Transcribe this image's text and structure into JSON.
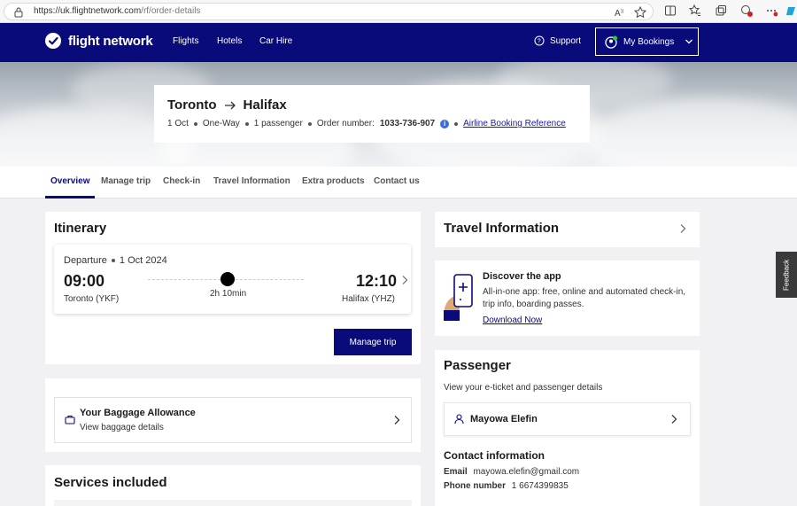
{
  "browser": {
    "url_host": "https://uk.flightnetwork.com",
    "url_path": "/rf/order-details"
  },
  "nav": {
    "brand": "flight network",
    "links": [
      "Flights",
      "Hotels",
      "Car Hire"
    ],
    "support": "Support",
    "my_bookings": "My Bookings"
  },
  "summary": {
    "origin": "Toronto",
    "destination": "Halifax",
    "date": "1 Oct",
    "trip_type": "One-Way",
    "passengers": "1 passenger",
    "order_label": "Order number:",
    "order_number": "1033-736-907",
    "booking_ref_link": "Airline Booking Reference"
  },
  "tabs": [
    "Overview",
    "Manage trip",
    "Check-in",
    "Travel Information",
    "Extra products",
    "Contact us"
  ],
  "itinerary": {
    "title": "Itinerary",
    "departure_label": "Departure",
    "departure_date": "1 Oct 2024",
    "dep_time": "09:00",
    "dep_place": "Toronto (YKF)",
    "duration": "2h 10min",
    "arr_time": "12:10",
    "arr_place": "Halifax (YHZ)",
    "manage_button": "Manage trip"
  },
  "baggage": {
    "title": "Your Baggage Allowance",
    "subtitle": "View baggage details"
  },
  "services": {
    "title": "Services included"
  },
  "travel_info": {
    "title": "Travel Information"
  },
  "app_promo": {
    "title": "Discover the app",
    "text": "All-in-one app: free, online and automated check-in, trip info, boarding passes.",
    "link": "Download Now"
  },
  "passenger": {
    "title": "Passenger",
    "subtitle": "View your e-ticket and passenger details",
    "name": "Mayowa Elefin",
    "contact_title": "Contact information",
    "email_label": "Email",
    "email": "mayowa.elefin@gmail.com",
    "phone_label": "Phone number",
    "phone": "1 6674399835"
  },
  "feedback": "Feedback",
  "colors": {
    "brand_navy": "#0a0b7a",
    "accent_blue": "#3b6fd8"
  }
}
